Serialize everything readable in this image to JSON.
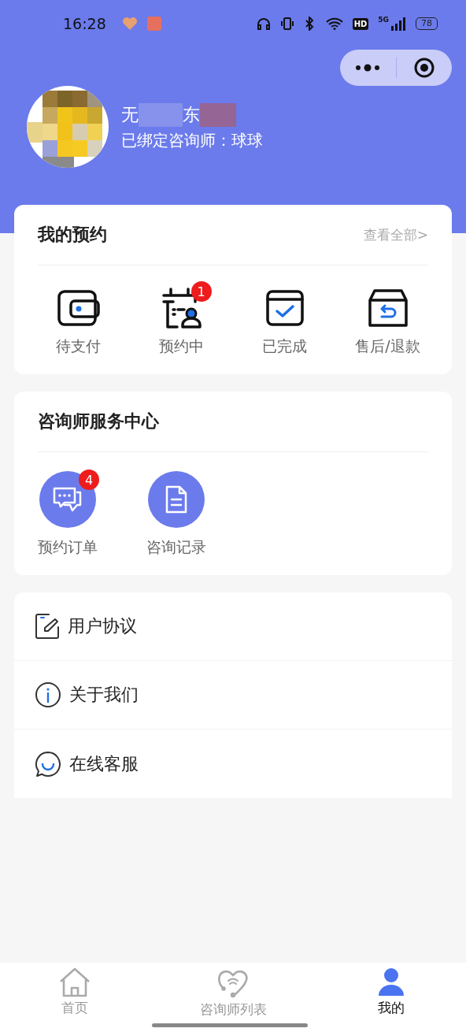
{
  "status_bar": {
    "time": "16:28",
    "hd": "HD",
    "network": "5G",
    "battery": "78"
  },
  "profile": {
    "name_parts": [
      "无",
      "东"
    ],
    "subtitle": "已绑定咨询师：球球"
  },
  "appointments": {
    "title": "我的预约",
    "link": "查看全部>",
    "items": [
      {
        "kind": "wallet",
        "label": "待支付"
      },
      {
        "kind": "calendar",
        "label": "预约中",
        "badge": "1"
      },
      {
        "kind": "done",
        "label": "已完成"
      },
      {
        "kind": "refund",
        "label": "售后/退款"
      }
    ]
  },
  "service_center": {
    "title": "咨询师服务中心",
    "items": [
      {
        "kind": "chat",
        "label": "预约订单",
        "badge": "4"
      },
      {
        "kind": "doc",
        "label": "咨询记录"
      }
    ]
  },
  "menu": [
    {
      "kind": "agreement",
      "label": "用户协议"
    },
    {
      "kind": "about",
      "label": "关于我们"
    },
    {
      "kind": "support",
      "label": "在线客服"
    }
  ],
  "tab_bar": [
    {
      "kind": "home",
      "label": "首页",
      "selected": false
    },
    {
      "kind": "counselors",
      "label": "咨询师列表",
      "selected": false
    },
    {
      "kind": "me",
      "label": "我的",
      "selected": true
    }
  ]
}
